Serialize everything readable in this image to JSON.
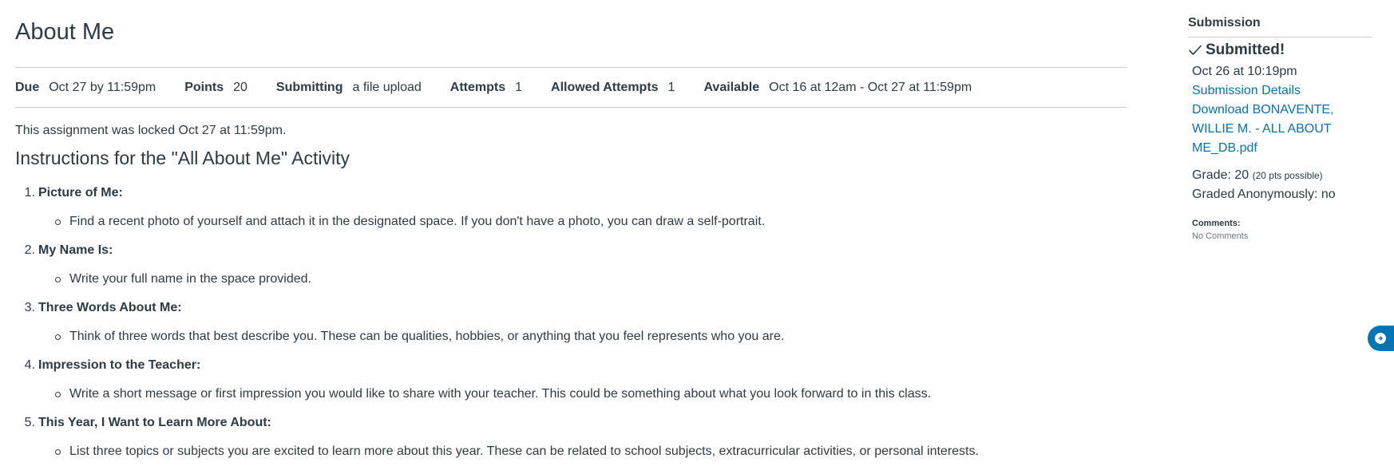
{
  "page": {
    "title": "About Me"
  },
  "details": [
    {
      "label": "Due",
      "value": "Oct 27 by 11:59pm"
    },
    {
      "label": "Points",
      "value": "20"
    },
    {
      "label": "Submitting",
      "value": "a file upload"
    },
    {
      "label": "Attempts",
      "value": "1"
    },
    {
      "label": "Allowed Attempts",
      "value": "1"
    },
    {
      "label": "Available",
      "value": "Oct 16 at 12am - Oct 27 at 11:59pm"
    }
  ],
  "locked_message": "This assignment was locked Oct 27 at 11:59pm.",
  "instructions": {
    "title": "Instructions for the \"All About Me\" Activity",
    "steps": [
      {
        "num": "1.",
        "title": "Picture of Me:",
        "bullet": "Find a recent photo of yourself and attach it in the designated space. If you don't have a photo, you can draw a self-portrait."
      },
      {
        "num": "2.",
        "title": "My Name Is:",
        "bullet": "Write your full name in the space provided."
      },
      {
        "num": "3.",
        "title": "Three Words About Me:",
        "bullet": "Think of three words that best describe you. These can be qualities, hobbies, or anything that you feel represents who you are."
      },
      {
        "num": "4.",
        "title": "Impression to the Teacher:",
        "bullet": "Write a short message or first impression you would like to share with your teacher. This could be something about what you look forward to in this class."
      },
      {
        "num": "5.",
        "title": "This Year, I Want to Learn More About:",
        "bullet": "List three topics or subjects you are excited to learn more about this year. These can be related to school subjects, extracurricular activities, or personal interests."
      }
    ]
  },
  "sidebar": {
    "heading": "Submission",
    "status": "Submitted!",
    "submitted_date": "Oct 26 at 10:19pm",
    "details_link": "Submission Details",
    "download_link_lines": [
      "Download BONAVENTE,",
      "WILLIE M. - ALL ABOUT",
      "ME_DB.pdf"
    ],
    "grade_label": "Grade: 20",
    "grade_possible": "(20 pts possible)",
    "anonymous": "Graded Anonymously: no",
    "comments_label": "Comments:",
    "comments_value": "No Comments"
  },
  "icons": {
    "status": "checkmark-icon",
    "tray": "tray-toggle-icon"
  },
  "colors": {
    "text": "#2d3b45",
    "link": "#0374b5",
    "divider": "#c7cdd1",
    "muted": "#6b7780"
  }
}
